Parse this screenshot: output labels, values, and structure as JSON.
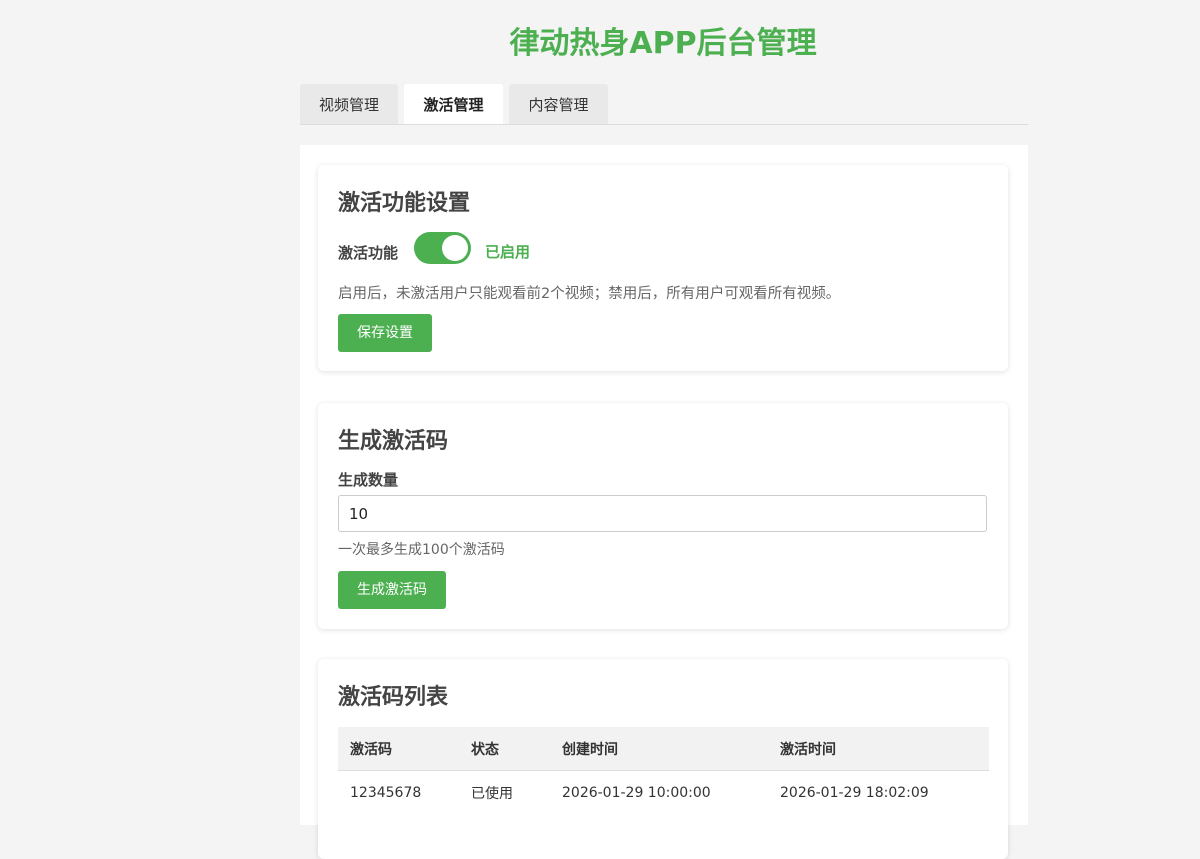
{
  "app": {
    "title": "律动热身APP后台管理"
  },
  "tabs": [
    {
      "label": "视频管理",
      "active": false
    },
    {
      "label": "激活管理",
      "active": true
    },
    {
      "label": "内容管理",
      "active": false
    }
  ],
  "activation_settings": {
    "title": "激活功能设置",
    "toggle_label": "激活功能",
    "toggle_on": true,
    "status_text": "已启用",
    "description": "启用后，未激活用户只能观看前2个视频；禁用后，所有用户可观看所有视频。",
    "save_button": "保存设置"
  },
  "generate": {
    "title": "生成激活码",
    "quantity_label": "生成数量",
    "quantity_value": "10",
    "hint": "一次最多生成100个激活码",
    "generate_button": "生成激活码"
  },
  "code_list": {
    "title": "激活码列表",
    "columns": [
      "激活码",
      "状态",
      "创建时间",
      "激活时间"
    ],
    "rows": [
      {
        "code": "12345678",
        "status": "已使用",
        "created": "2026-01-29 10:00:00",
        "activated": "2026-01-29 18:02:09"
      }
    ]
  },
  "colors": {
    "accent": "#4caf50",
    "used_status": "#e53935"
  }
}
